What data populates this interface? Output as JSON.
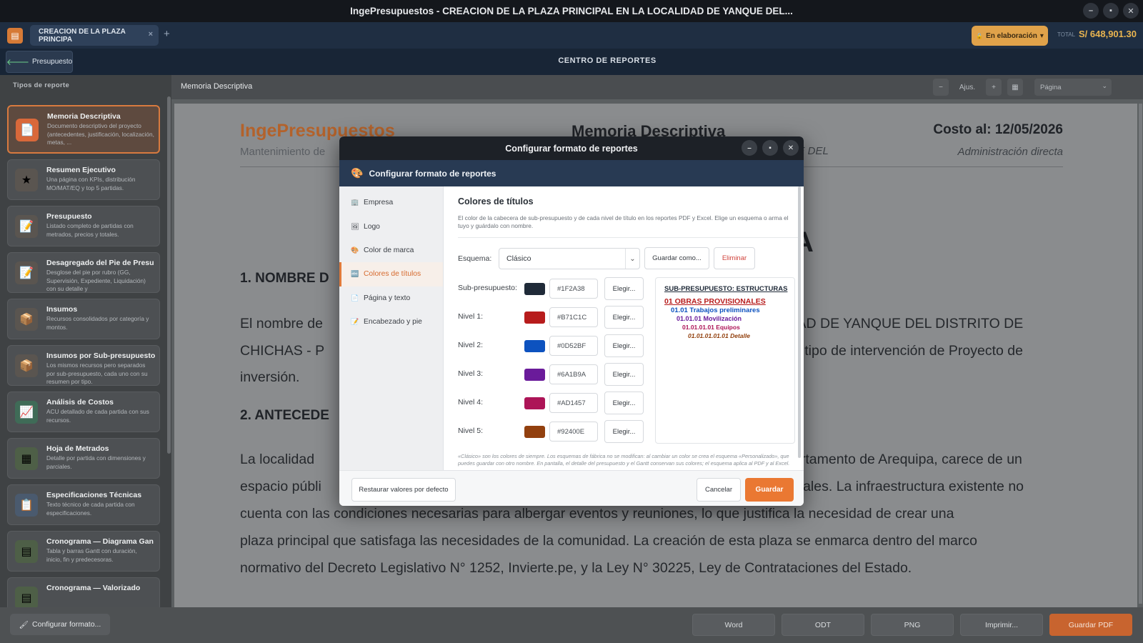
{
  "window": {
    "app_name": "IngePresupuestos",
    "title_separator": " - ",
    "document_title": "CREACION DE LA PLAZA PRINCIPAL EN LA LOCALIDAD DE YANQUE DEL...",
    "controls": {
      "minimize": "–",
      "maximize": "▪",
      "close": "✕"
    }
  },
  "tabbar": {
    "tab_label": "CREACION DE LA PLAZA PRINCIPA",
    "tab_close": "×",
    "new_tab": "+",
    "status_icon": "🔒",
    "status_label": "En elaboración",
    "status_caret": "▾",
    "total_label": "TOTAL",
    "total_value": "S/ 648,901.30"
  },
  "navbar": {
    "back_arrow": "🡐",
    "back_label": "Presupuesto",
    "title": "CENTRO DE REPORTES"
  },
  "sidebar": {
    "header": "Tipos de reporte",
    "items": [
      {
        "title": "Memoria Descriptiva",
        "desc": "Documento descriptivo del proyecto (antecedentes, justificación, localización, metas, ...",
        "icon": "📄",
        "icon_name": "document-icon",
        "color": "#d9683a"
      },
      {
        "title": "Resumen Ejecutivo",
        "desc": "Una página con KPIs, distribución MO/MAT/EQ y top 5 partidas.",
        "icon": "★",
        "icon_name": "star-icon",
        "color": "#5a5550"
      },
      {
        "title": "Presupuesto",
        "desc": "Listado completo de partidas con metrados, precios y totales.",
        "icon": "📝",
        "icon_name": "edit-document-icon",
        "color": "#5a5550"
      },
      {
        "title": "Desagregado del Pie de Presu",
        "desc": "Desglose del pie por rubro (GG, Supervisión, Expediente, Liquidación) con su detalle y",
        "icon": "📝",
        "icon_name": "edit-document-icon",
        "color": "#5a5550"
      },
      {
        "title": "Insumos",
        "desc": "Recursos consolidados por categoría y montos.",
        "icon": "📦",
        "icon_name": "box-icon",
        "color": "#5a5550"
      },
      {
        "title": "Insumos por Sub-presupuesto",
        "desc": "Los mismos recursos pero separados por sub-presupuesto, cada uno con su resumen por tipo.",
        "icon": "📦",
        "icon_name": "box-icon",
        "color": "#5a5550"
      },
      {
        "title": "Análisis de Costos",
        "desc": "ACU detallado de cada partida con sus recursos.",
        "icon": "📈",
        "icon_name": "chart-icon",
        "color": "#3f6b57"
      },
      {
        "title": "Hoja de Metrados",
        "desc": "Detalle por partida con dimensiones y parciales.",
        "icon": "▦",
        "icon_name": "sheet-icon",
        "color": "#4e5f47"
      },
      {
        "title": "Especificaciones Técnicas",
        "desc": "Texto técnico de cada partida con especificaciones.",
        "icon": "📋",
        "icon_name": "clipboard-icon",
        "color": "#4a5a6e"
      },
      {
        "title": "Cronograma — Diagrama Gan",
        "desc": "Tabla y barras Gantt con duración, inicio, fin y predecesoras.",
        "icon": "▤",
        "icon_name": "calendar-icon",
        "color": "#4e5f47"
      },
      {
        "title": "Cronograma — Valorizado",
        "desc": "",
        "icon": "▤",
        "icon_name": "calendar-icon",
        "color": "#4e5f47"
      }
    ]
  },
  "preview_toolbar": {
    "doc_name": "Memoria Descriptiva",
    "zoom_out": "−",
    "fit": "Ajus.",
    "zoom_in": "+",
    "page_icon": "▦",
    "page_mode": "Página",
    "page_mode_caret": "⌄"
  },
  "page": {
    "brand": "IngePresupuestos",
    "brand_sub": "Mantenimiento de",
    "doc_title": "Memoria Descriptiva",
    "doc_loc": "QUE DEL",
    "costo": "Costo al: 12/05/2026",
    "admin": "Administración directa",
    "big_a": "A",
    "h1_nombre": "1. NOMBRE D",
    "para1_a": "El nombre de",
    "para1_b": "IDAD DE YANQUE DEL DISTRITO DE",
    "para1_c": "CHICHAS - P",
    "para1_d": "n tipo de intervención de Proyecto de",
    "para1_e": "inversión.",
    "h2_antecedentes": "2. ANTECEDE",
    "para2_a": "La localidad",
    "para2_b": "artamento de Arequipa, carece de un",
    "para2_c": "espacio públi",
    "para2_d": "ciales. La infraestructura existente no",
    "para2_e": "cuenta con las condiciones necesarias para albergar eventos y reuniones, lo que justifica la necesidad de crear una",
    "para2_f": "plaza principal que satisfaga las necesidades de la comunidad. La creación de esta plaza se enmarca dentro del marco",
    "para2_g": "normativo del Decreto Legislativo N° 1252, Invierte.pe, y la Ley N° 30225, Ley de Contrataciones del Estado."
  },
  "footer": {
    "config_icon": "🖌",
    "config_label": "Configurar formato...",
    "export_word": "Word",
    "export_odt": "ODT",
    "export_png": "PNG",
    "print": "Imprimir...",
    "save_pdf": "Guardar PDF"
  },
  "dialog": {
    "window_title": "Configurar formato de reportes",
    "header_icon": "🎨",
    "header_title": "Configurar formato de reportes",
    "controls": {
      "minimize": "–",
      "maximize": "▪",
      "close": "✕"
    },
    "nav": [
      {
        "label": "Empresa",
        "icon": "🏢",
        "icon_name": "building-icon"
      },
      {
        "label": "Logo",
        "icon": "🖼",
        "icon_name": "image-icon"
      },
      {
        "label": "Color de marca",
        "icon": "🎨",
        "icon_name": "palette-icon"
      },
      {
        "label": "Colores de títulos",
        "icon": "🔤",
        "icon_name": "text-color-icon"
      },
      {
        "label": "Página y texto",
        "icon": "📄",
        "icon_name": "page-icon"
      },
      {
        "label": "Encabezado y pie",
        "icon": "📝",
        "icon_name": "header-footer-icon"
      }
    ],
    "section_title": "Colores de títulos",
    "section_desc": "El color de la cabecera de sub-presupuesto y de cada nivel de título en los reportes PDF y Excel. Elige un esquema o arma el tuyo y guárdalo con nombre.",
    "scheme_label": "Esquema:",
    "scheme_value": "Clásico",
    "scheme_caret": "⌄",
    "save_as": "Guardar como...",
    "delete": "Eliminar",
    "pick_label": "Elegir...",
    "levels": [
      {
        "label": "Sub-presupuesto:",
        "hex": "#1F2A38"
      },
      {
        "label": "Nivel 1:",
        "hex": "#B71C1C"
      },
      {
        "label": "Nivel 2:",
        "hex": "#0D52BF"
      },
      {
        "label": "Nivel 3:",
        "hex": "#6A1B9A"
      },
      {
        "label": "Nivel 4:",
        "hex": "#AD1457"
      },
      {
        "label": "Nivel 5:",
        "hex": "#92400E"
      }
    ],
    "preview": {
      "sub": "SUB-PRESUPUESTO: ESTRUCTURAS",
      "n1": "01 OBRAS PROVISIONALES",
      "n2": "01.01 Trabajos preliminares",
      "n3": "01.01.01 Movilización",
      "n4": "01.01.01.01 Equipos",
      "n5": "01.01.01.01.01 Detalle"
    },
    "note": "«Clásico» son los colores de siempre. Los esquemas de fábrica no se modifican: al cambiar un color se crea el esquema «Personalizado», que puedes guardar con otro nombre. En pantalla, el detalle del presupuesto y el Gantt conservan sus colores; el esquema aplica al PDF y al Excel. Word no usa colores de nivel.",
    "restore": "Restaurar valores por defecto",
    "cancel": "Cancelar",
    "save": "Guardar"
  }
}
